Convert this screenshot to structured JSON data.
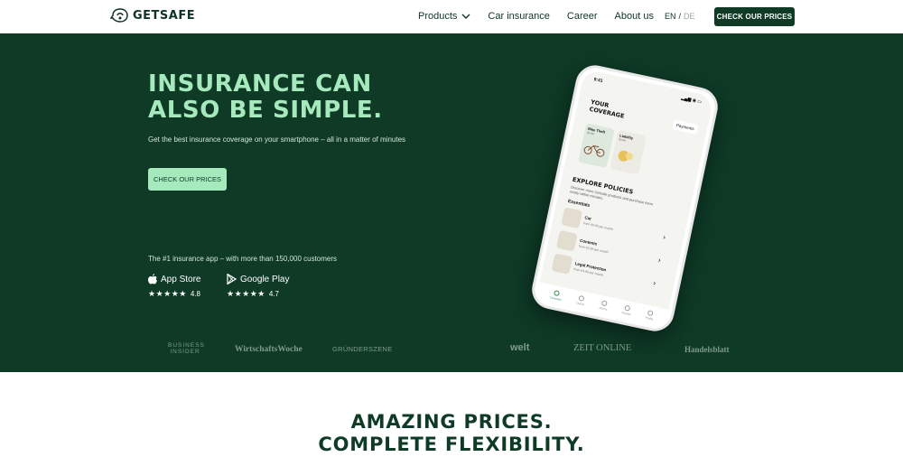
{
  "nav": {
    "logo_text": "GETSAFE",
    "links": [
      "Products",
      "Car insurance",
      "Career",
      "About us"
    ],
    "lang_active": "EN",
    "lang_sep": "/",
    "lang_inactive": "DE",
    "cta": "CHECK OUR PRICES"
  },
  "hero": {
    "title_line1": "INSURANCE CAN",
    "title_line2": "ALSO BE SIMPLE.",
    "subtitle": "Get the best insurance coverage on your smartphone – all in a matter of minutes",
    "cta": "CHECK OUR PRICES",
    "tagline": "The #1 insurance app – with more than 150,000 customers",
    "stores": [
      {
        "name": "App Store",
        "stars": "★★★★★",
        "rating": "4.8"
      },
      {
        "name": "Google Play",
        "stars": "★★★★★",
        "rating": "4.7"
      }
    ],
    "press": [
      "BUSINESS INSIDER",
      "WirtschaftsWoche",
      "GRÜNDERSZENE",
      "welt",
      "ZEIT ONLINE",
      "Handelsblatt"
    ]
  },
  "phone": {
    "time": "9:41",
    "status": "▂▄▆ ◉ ▭",
    "title_line1": "YOUR",
    "title_line2": "COVERAGE",
    "payments": "Payments",
    "cards": [
      {
        "label": "Bike Theft",
        "sub": "$4.99"
      },
      {
        "label": "Liability",
        "sub": "$3.99"
      }
    ],
    "explore": "EXPLORE POLICIES",
    "explore_desc": "Discover more Getsafe products and purchase them easily within minutes.",
    "essentials": "Essentials",
    "policies": [
      {
        "name": "Car",
        "price": "from €9.99 per month"
      },
      {
        "name": "Contents",
        "price": "from €2.99 per month"
      },
      {
        "name": "Legal Protection",
        "price": "from €4.99 per month"
      }
    ],
    "tabs": [
      "Coverage",
      "Claims",
      "Advice",
      "Friends",
      "Profile"
    ]
  },
  "section2": {
    "line1": "AMAZING PRICES.",
    "line2": "COMPLETE FLEXIBILITY."
  },
  "colors": {
    "hero_bg": "#0e3a26",
    "accent": "#a6e9bd",
    "nav_cta_bg": "#0f3b26"
  }
}
